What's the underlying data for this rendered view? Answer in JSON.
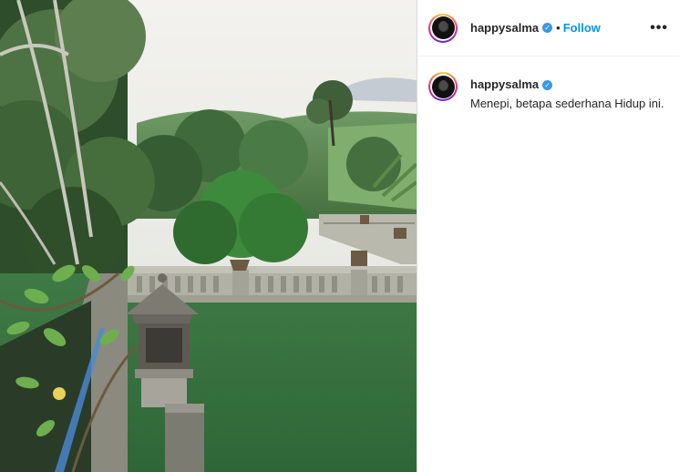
{
  "post": {
    "image": {
      "alt": "",
      "icon": "garden-view-photo"
    },
    "header": {
      "username": "happysalma",
      "verified_icon": "verified-badge-icon",
      "separator": "•",
      "follow_label": "Follow",
      "more_label": "•••"
    },
    "caption": {
      "username": "happysalma",
      "text": "Menepi, betapa sederhana Hidup ini."
    }
  },
  "colors": {
    "accent": "#0095f6",
    "verified": "#3897f0",
    "text": "#262626",
    "border": "#dbdbdb"
  }
}
